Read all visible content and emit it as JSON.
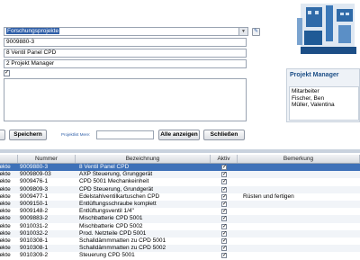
{
  "form": {
    "forschungsprojekte": "Forschungsprojekte",
    "project_number": "9009880-3",
    "description": "8 Ventil Panel CPD",
    "status": "2 Projekt Manager"
  },
  "projekt_manager": {
    "title": "Projekt Manager",
    "header": "Mitarbeiter",
    "names": [
      "Fischer, Ben",
      "Müller, Valentina"
    ]
  },
  "actions": {
    "save_label": "Speichern",
    "filter_label": "Projektlist Mere:",
    "show_all_label": "Alle anzeigen",
    "close_label": "Schließen"
  },
  "table": {
    "columns": [
      "Nummer",
      "Bezeichnung",
      "Aktiv",
      "Bemerkung"
    ],
    "rows": [
      {
        "prefix": "jekte",
        "number": "9009880-3",
        "name": "8 Ventil Panel CPD",
        "active": true,
        "remark": ""
      },
      {
        "prefix": "jekte",
        "number": "9009809-03",
        "name": "AXP Steuerung, Grunggerät",
        "active": true,
        "remark": ""
      },
      {
        "prefix": "jekte",
        "number": "9009476-1",
        "name": "CPD 5001 Mechankeinheit",
        "active": true,
        "remark": ""
      },
      {
        "prefix": "jekte",
        "number": "9009809-3",
        "name": "CPD Steuerung, Grundgerät",
        "active": true,
        "remark": ""
      },
      {
        "prefix": "jekte",
        "number": "9009477-1",
        "name": "Edelstahlventilkartuschen CPD",
        "active": true,
        "remark": "Rüsten und fertigen"
      },
      {
        "prefix": "jekte",
        "number": "9009150-1",
        "name": "Entlüftungsschraube komplett",
        "active": true,
        "remark": ""
      },
      {
        "prefix": "jekte",
        "number": "9009148-2",
        "name": "Entlüftungsventil 1/4\"",
        "active": true,
        "remark": ""
      },
      {
        "prefix": "jekte",
        "number": "9009883-2",
        "name": "Mischbatterie CPD 5001",
        "active": true,
        "remark": ""
      },
      {
        "prefix": "jekte",
        "number": "9010031-2",
        "name": "Mischbatterie CPD 5002",
        "active": true,
        "remark": ""
      },
      {
        "prefix": "jekte",
        "number": "9010032-2",
        "name": "Prod. Netzteile CPD 5001",
        "active": true,
        "remark": ""
      },
      {
        "prefix": "jekte",
        "number": "9010308-1",
        "name": "Schalldämmmatten zu CPD 5001",
        "active": true,
        "remark": ""
      },
      {
        "prefix": "jekte",
        "number": "9010308-1",
        "name": "Schalldämmmatten zu CPD 5002",
        "active": true,
        "remark": ""
      },
      {
        "prefix": "jekte",
        "number": "9010309-2",
        "name": "Steuerung CPD 5001",
        "active": true,
        "remark": ""
      }
    ]
  },
  "colors": {
    "selection": "#3e71b8",
    "panel_title": "#1c4e86",
    "machine": "#2f6aa8"
  }
}
